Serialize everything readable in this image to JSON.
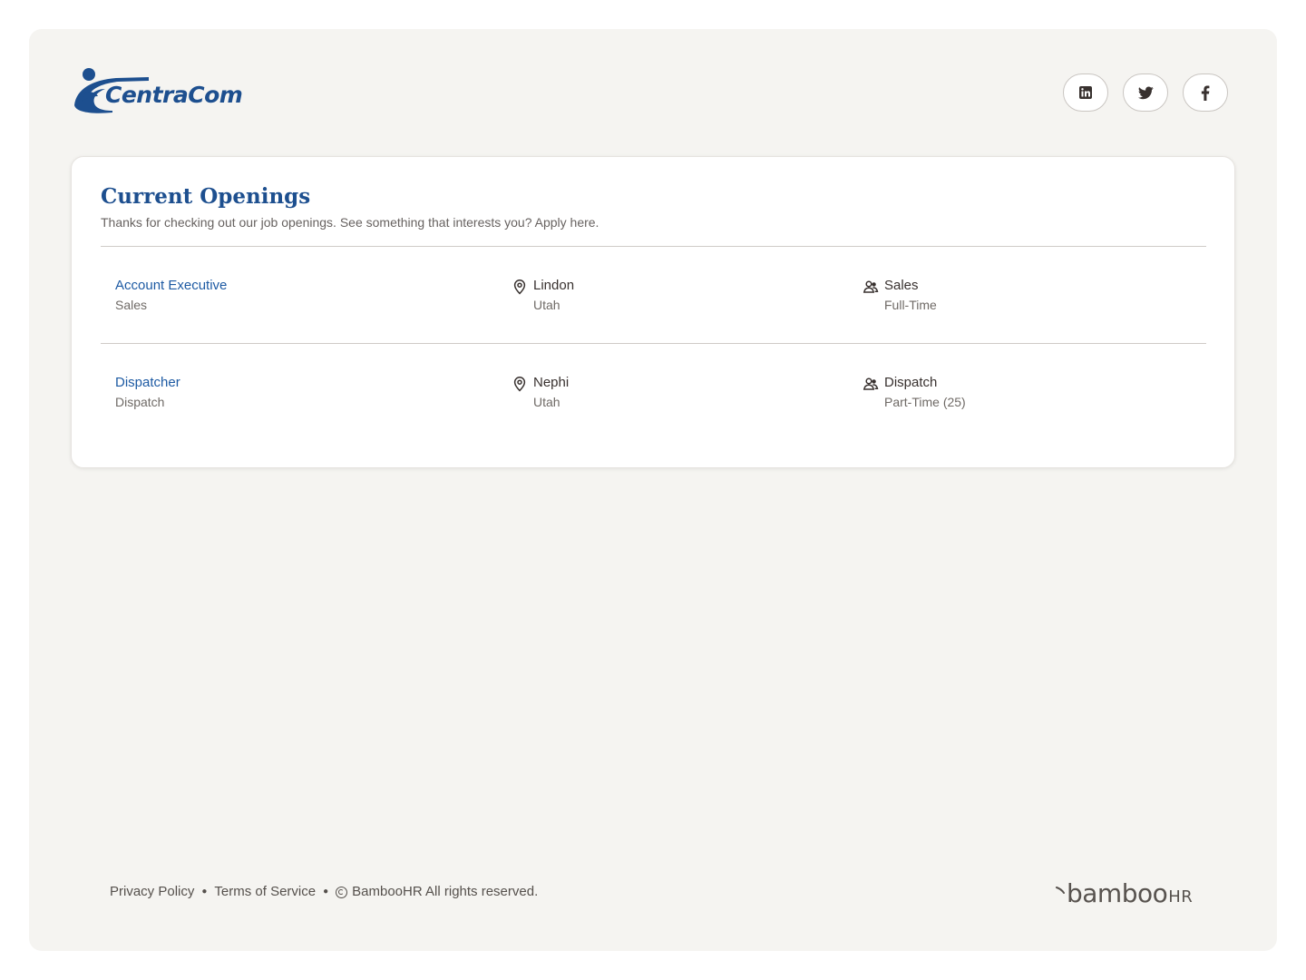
{
  "header": {
    "logo_text": "CentraCom",
    "social": [
      {
        "name": "linkedin",
        "icon": "linkedin-icon"
      },
      {
        "name": "twitter",
        "icon": "twitter-icon"
      },
      {
        "name": "facebook",
        "icon": "facebook-icon"
      }
    ]
  },
  "openings": {
    "title": "Current Openings",
    "subtitle": "Thanks for checking out our job openings. See something that interests you? Apply here.",
    "jobs": [
      {
        "title": "Account Executive",
        "department": "Sales",
        "city": "Lindon",
        "state": "Utah",
        "team": "Sales",
        "employment_type": "Full-Time"
      },
      {
        "title": "Dispatcher",
        "department": "Dispatch",
        "city": "Nephi",
        "state": "Utah",
        "team": "Dispatch",
        "employment_type": "Part-Time (25)"
      }
    ]
  },
  "footer": {
    "privacy": "Privacy Policy",
    "terms": "Terms of Service",
    "copyright": "BambooHR All rights reserved.",
    "brand_word": "bamboo",
    "brand_suffix": "HR"
  },
  "colors": {
    "brand_blue": "#1d4f8f",
    "link_blue": "#1d5aa3",
    "page_bg": "#f5f4f1"
  }
}
